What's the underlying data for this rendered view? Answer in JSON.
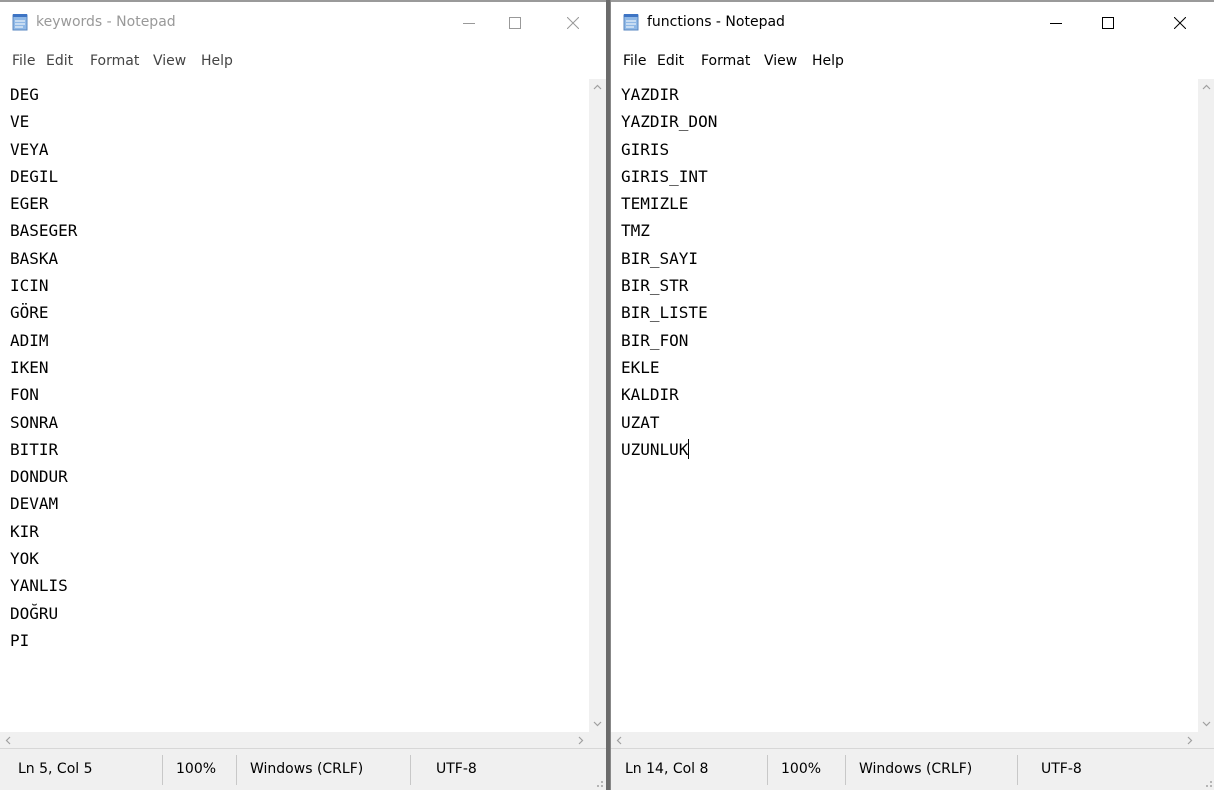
{
  "left": {
    "title": "keywords - Notepad",
    "menu": [
      "File",
      "Edit",
      "Format",
      "View",
      "Help"
    ],
    "lines": [
      "DEG",
      "VE",
      "VEYA",
      "DEGIL",
      "EGER",
      "BASEGER",
      "BASKA",
      "ICIN",
      "GÖRE",
      "ADIM",
      "IKEN",
      "FON",
      "SONRA",
      "BITIR",
      "DONDUR",
      "DEVAM",
      "KIR",
      "YOK",
      "YANLIS",
      "DOĞRU",
      "PI"
    ],
    "status": {
      "position": "Ln 5, Col 5",
      "zoom": "100%",
      "line_endings": "Windows (CRLF)",
      "encoding": "UTF-8"
    }
  },
  "right": {
    "title": "functions - Notepad",
    "menu": [
      "File",
      "Edit",
      "Format",
      "View",
      "Help"
    ],
    "lines": [
      "YAZDIR",
      "YAZDIR_DON",
      "GIRIS",
      "GIRIS_INT",
      "TEMIZLE",
      "TMZ",
      "BIR_SAYI",
      "BIR_STR",
      "BIR_LISTE",
      "BIR_FON",
      "EKLE",
      "KALDIR",
      "UZAT",
      "UZUNLUK"
    ],
    "status": {
      "position": "Ln 14, Col 8",
      "zoom": "100%",
      "line_endings": "Windows (CRLF)",
      "encoding": "UTF-8"
    }
  },
  "icons": {
    "app": "notepad-icon",
    "minimize": "minimize-icon",
    "maximize": "maximize-icon",
    "close": "close-icon",
    "scroll_up": "chevron-up-icon",
    "scroll_down": "chevron-down-icon",
    "scroll_left": "chevron-left-icon",
    "scroll_right": "chevron-right-icon"
  },
  "colors": {
    "inactive_title": "#999999",
    "active_title": "#000000",
    "status_bg": "#f0f0f0",
    "divider": "#6b6b6b"
  }
}
